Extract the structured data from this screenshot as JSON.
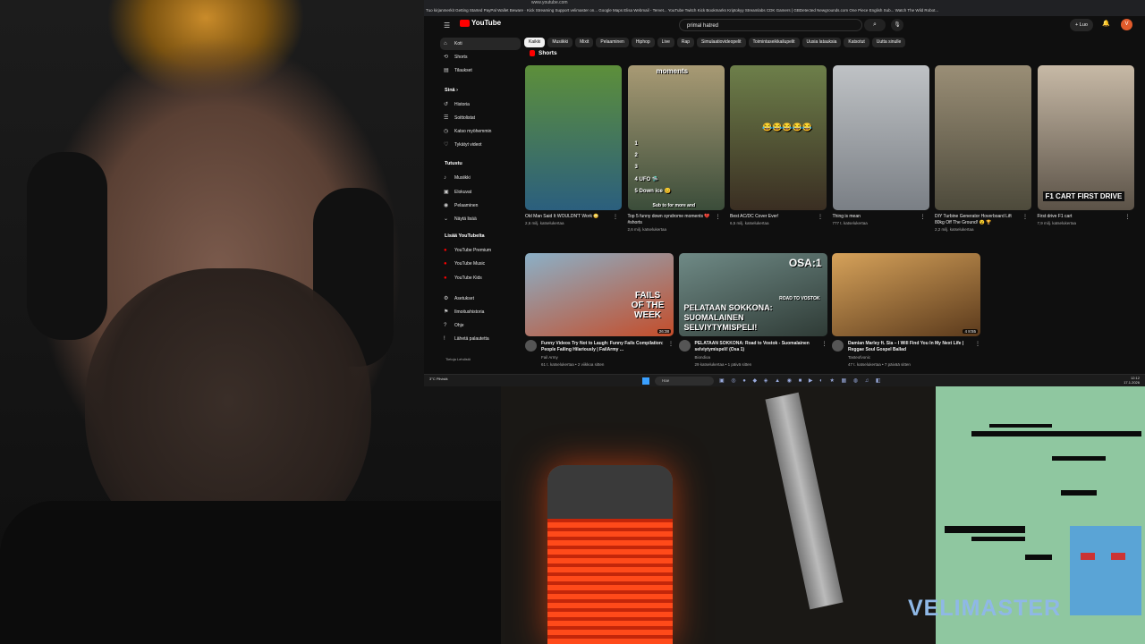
{
  "browser": {
    "url": "www.youtube.com",
    "bookmarks": [
      "Tuo kirjanmerkit",
      "Getting Started",
      "PayPal Wallet",
      "Beware · Kick Streaming",
      "Support velimaster on...",
      "Google Maps",
      "Elisa Webmail - Tervet...",
      "YouTube",
      "Twitch",
      "Kick",
      "Bookmarks",
      "Kriptokyy",
      "Streamlabs",
      "CDK",
      "Gamers | GBDetected",
      "Newgrounds.com",
      "One Piece English Sub...",
      "Watch The Wild Robot..."
    ]
  },
  "youtube": {
    "logo": "YouTube",
    "search_value": "primal hatred",
    "create_label": "Luo",
    "avatar_letter": "V",
    "sidebar": {
      "main": [
        {
          "icon": "home-icon",
          "glyph": "⌂",
          "label": "Koti"
        },
        {
          "icon": "shorts-icon",
          "glyph": "⟲",
          "label": "Shorts"
        },
        {
          "icon": "subscriptions-icon",
          "glyph": "▤",
          "label": "Tilaukset"
        }
      ],
      "you_header": "Sinä  ›",
      "you": [
        {
          "icon": "history-icon",
          "glyph": "↺",
          "label": "Historia"
        },
        {
          "icon": "playlists-icon",
          "glyph": "☰",
          "label": "Soittolistat"
        },
        {
          "icon": "watch-later-icon",
          "glyph": "◷",
          "label": "Katso myöhemmin"
        },
        {
          "icon": "liked-icon",
          "glyph": "♡",
          "label": "Tykätyt videot"
        }
      ],
      "explore_header": "Tutustu",
      "explore": [
        {
          "icon": "music-icon",
          "glyph": "♪",
          "label": "Musiikki"
        },
        {
          "icon": "movies-icon",
          "glyph": "▣",
          "label": "Elokuvat"
        },
        {
          "icon": "gaming-icon",
          "glyph": "◉",
          "label": "Pelaaminen"
        },
        {
          "icon": "chevron-down-icon",
          "glyph": "⌄",
          "label": "Näytä lisää"
        }
      ],
      "more_header": "Lisää YouTubelta",
      "more": [
        {
          "icon": "youtube-premium-icon",
          "glyph": "●",
          "label": "YouTube Premium"
        },
        {
          "icon": "youtube-music-icon",
          "glyph": "●",
          "label": "YouTube Music"
        },
        {
          "icon": "youtube-kids-icon",
          "glyph": "●",
          "label": "YouTube Kids"
        }
      ],
      "settings": [
        {
          "icon": "gear-icon",
          "glyph": "⚙",
          "label": "Asetukset"
        },
        {
          "icon": "flag-icon",
          "glyph": "⚑",
          "label": "Ilmoitushistoria"
        },
        {
          "icon": "help-icon",
          "glyph": "?",
          "label": "Ohje"
        },
        {
          "icon": "feedback-icon",
          "glyph": "!",
          "label": "Lähetä palautetta"
        }
      ],
      "footer": "Tietoja   Lehdistö"
    },
    "chips": [
      "Kaikki",
      "Musiikki",
      "Mixit",
      "Pelaaminen",
      "Hiphop",
      "Live",
      "Rap",
      "Simulaatiovideopelit",
      "Toimintaseikkailupelit",
      "Uusia latauksia",
      "Katsotut",
      "Uutta sinulle"
    ],
    "shorts_title": "Shorts",
    "shorts": [
      {
        "title": "Old Man Said It WOULDN'T Work 😳",
        "views": "2,6 milj. katselukertaa",
        "colors": [
          "#5d8f3a",
          "#2b5f7e"
        ]
      },
      {
        "title": "Top 5 funny down syndrome moments 💔 #shorts",
        "views": "2,6 milj. katselukertaa",
        "colors": [
          "#a89a74",
          "#3b4d3a"
        ],
        "overlay": "moments",
        "list": [
          "1",
          "2",
          "3",
          "4 UFO 🛸",
          "5 Down ice 😊"
        ],
        "caption": "Sub to for more and"
      },
      {
        "title": "Best AC/DC Cover Ever!",
        "views": "6,5 milj. katselukertaa",
        "colors": [
          "#6d7f4a",
          "#3a2e22"
        ],
        "overlay": "😂😂😂😂😂"
      },
      {
        "title": "Thing is mean",
        "views": "777 t. katselukertaa",
        "colors": [
          "#bfc2c5",
          "#7a7f85"
        ]
      },
      {
        "title": "DIY Turbine Generator Hoverboard Lift 80kg Off The Ground! 😮 🏆",
        "views": "2,2 milj. katselukertaa",
        "colors": [
          "#9a8e76",
          "#4d4a3b"
        ]
      },
      {
        "title": "First drive F1 cart",
        "views": "7,9 milj. katselukertaa",
        "colors": [
          "#c7b9a6",
          "#5b5247"
        ],
        "overlay": "F1 CART FIRST DRIVE"
      }
    ],
    "videos": [
      {
        "title": "Funny Videos Try Not to Laugh: Funny Fails Compilation: People Failing Hilariously | FailArmy ...",
        "channel": "Fail Army",
        "stats": "61 t. katselukertaa • 2 viikkoa sitten",
        "duration": "26:38",
        "colors": [
          "#8bb0c7",
          "#c44d2a"
        ],
        "overlay": "FAILS OF THE WEEK"
      },
      {
        "title": "PELATAAN SOKKONA: Road to Vostok - Suomalainen selviytymispeli! (Osa 1)",
        "channel": "Biondioa",
        "stats": "29 katselukertaa • 1 päivä sitten",
        "duration": "",
        "colors": [
          "#6f8a86",
          "#2f3b36"
        ],
        "overlay": "PELATAAN SOKKONA: SUOMALAINEN SELVIYTYMISPELI!",
        "overlay2": "OSA:1",
        "overlay3": "ROAD TO VOSTOK"
      },
      {
        "title": "Damian Marley ft. Sia – I Will Find You In My Next Life | Reggae Soul Gospel Ballad",
        "channel": "Tasteofvonic",
        "stats": "47 t. katselukertaa • 7 päivää sitten",
        "duration": "4 8:55",
        "colors": [
          "#d6a25a",
          "#5b3a1c"
        ]
      }
    ]
  },
  "taskbar": {
    "weather": "3°C Pilvistä",
    "search_placeholder": "Hae",
    "apps": "▣ ◎ ● ◆ ◈ ▲ ◉ ■ ▶ ◐ ★ ▦ ◍ ♫ ◧",
    "time": "12:12",
    "date": "17.1.2026"
  },
  "overlay": {
    "brand": "VELIMASTER"
  }
}
